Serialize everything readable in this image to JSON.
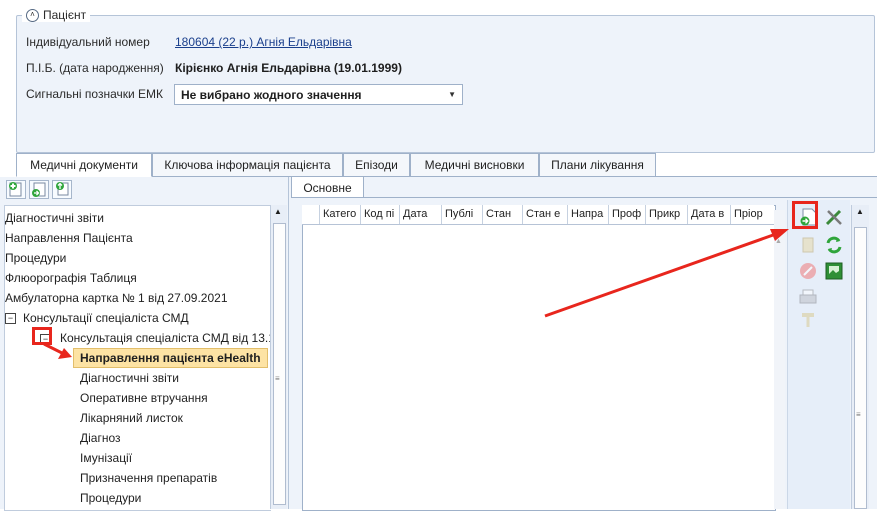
{
  "patient": {
    "legend": "Пацієнт",
    "id_label": "Індивідуальний номер",
    "id_value": "180604 (22 р.) Агнія Ельдарівна",
    "name_label": "П.І.Б. (дата народження)",
    "name_value": "Кірієнко Агнія Ельдарівна (19.01.1999)",
    "signal_label": "Сигнальні позначки ЕМК",
    "signal_value": "Не вибрано жодного значення"
  },
  "tabs": [
    {
      "label": "Медичні документи"
    },
    {
      "label": "Ключова інформація пацієнта"
    },
    {
      "label": "Епізоди"
    },
    {
      "label": "Медичні висновки"
    },
    {
      "label": "Плани лікування"
    }
  ],
  "tree": {
    "items": [
      "Діагностичні звіти",
      "Направлення Пацієнта",
      "Процедури",
      "Флюорографія Таблиця",
      "Амбулаторна картка № 1 від 27.09.2021",
      "Консультації спеціаліста СМД",
      "Консультація спеціаліста СМД від 13.1",
      "Направлення пацієнта eHealth",
      "Діагностичні звіти",
      "Оперативне втручання",
      "Лікарняний листок",
      "Діагноз",
      "Імунізації",
      "Призначення препаратів",
      "Процедури"
    ]
  },
  "subtab": {
    "label": "Основне"
  },
  "grid": {
    "columns": [
      "Катего",
      "Код пі",
      "Дата",
      "Публі",
      "Стан",
      "Стан е",
      "Напра",
      "Проф",
      "Прикр",
      "Дата в",
      "Пріор"
    ]
  },
  "colors": {
    "accent": "#e8261d",
    "selection": "#fde3a4",
    "link": "#1a3f8c"
  }
}
